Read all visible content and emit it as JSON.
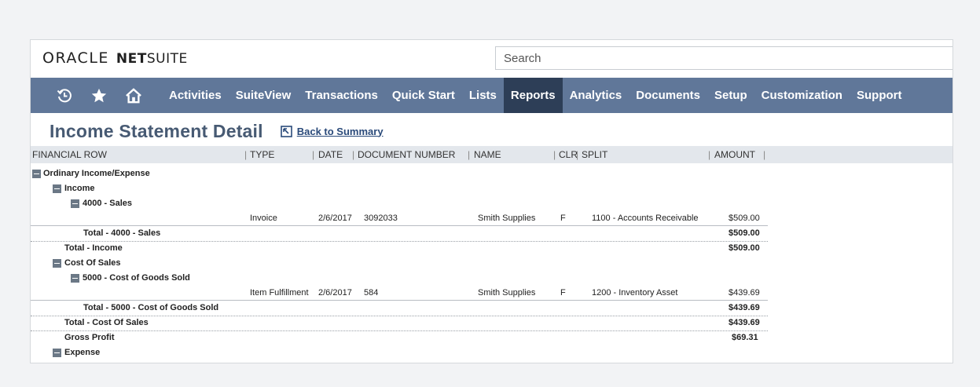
{
  "brand": {
    "oracle": "ORACLE",
    "net": "NET",
    "suite": "SUITE"
  },
  "search": {
    "placeholder": "Search"
  },
  "nav": {
    "icons": [
      "history-icon",
      "star-icon",
      "home-icon"
    ],
    "items": [
      {
        "label": "Activities"
      },
      {
        "label": "SuiteView"
      },
      {
        "label": "Transactions"
      },
      {
        "label": "Quick Start"
      },
      {
        "label": "Lists"
      },
      {
        "label": "Reports",
        "active": true
      },
      {
        "label": "Analytics"
      },
      {
        "label": "Documents"
      },
      {
        "label": "Setup"
      },
      {
        "label": "Customization"
      },
      {
        "label": "Support"
      }
    ]
  },
  "page": {
    "title": "Income Statement Detail",
    "back_link": "Back to Summary"
  },
  "columns": {
    "financial_row": "FINANCIAL ROW",
    "type": "TYPE",
    "date": "DATE",
    "document_number": "DOCUMENT NUMBER",
    "name": "NAME",
    "clr": "CLR",
    "split": "SPLIT",
    "amount": "AMOUNT"
  },
  "rows": {
    "ordinary": "Ordinary Income/Expense",
    "income": "Income",
    "sales_4000": "4000 - Sales",
    "txn1": {
      "type": "Invoice",
      "date": "2/6/2017",
      "doc": "3092033",
      "name": "Smith Supplies",
      "clr": "F",
      "split": "1100 - Accounts Receivable",
      "amount": "$509.00"
    },
    "total_4000": {
      "label": "Total - 4000 - Sales",
      "amount": "$509.00"
    },
    "total_income": {
      "label": "Total - Income",
      "amount": "$509.00"
    },
    "cost_of_sales": "Cost Of Sales",
    "cogs_5000": "5000 - Cost of Goods Sold",
    "txn2": {
      "type": "Item Fulfillment",
      "date": "2/6/2017",
      "doc": "584",
      "name": "Smith Supplies",
      "clr": "F",
      "split": "1200 - Inventory Asset",
      "amount": "$439.69"
    },
    "total_5000": {
      "label": "Total - 5000 - Cost of Goods Sold",
      "amount": "$439.69"
    },
    "total_cos": {
      "label": "Total - Cost Of Sales",
      "amount": "$439.69"
    },
    "gross_profit": {
      "label": "Gross Profit",
      "amount": "$69.31"
    },
    "expense": "Expense"
  },
  "colors": {
    "nav_bg": "#607799",
    "nav_active": "#2d3e57",
    "title": "#475a73",
    "header_bg": "#e3e7ec"
  }
}
